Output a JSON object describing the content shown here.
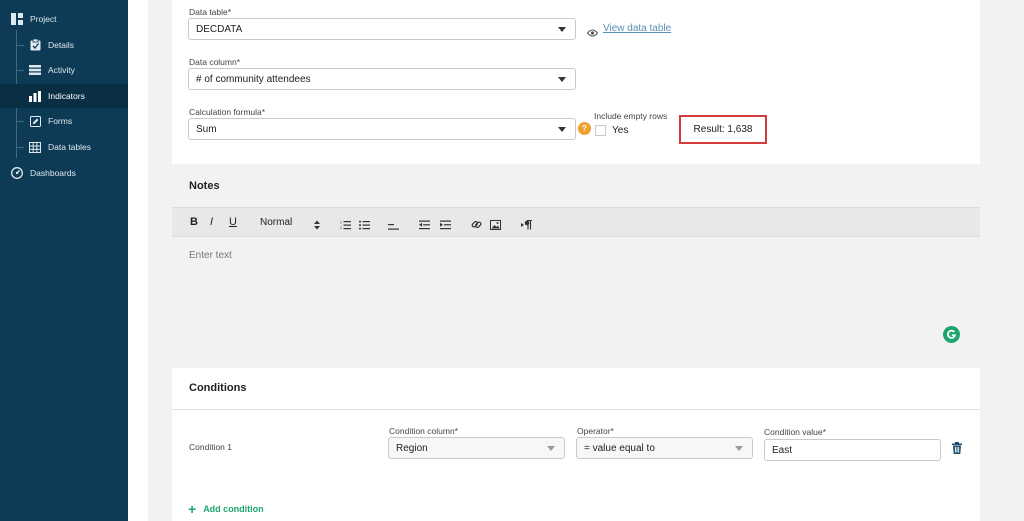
{
  "sidebar": {
    "project": "Project",
    "items": [
      {
        "label": "Details",
        "icon": "clipboard-icon"
      },
      {
        "label": "Activity",
        "icon": "list-icon"
      },
      {
        "label": "Indicators",
        "icon": "bar-chart-icon"
      },
      {
        "label": "Forms",
        "icon": "edit-icon"
      },
      {
        "label": "Data tables",
        "icon": "table-icon"
      }
    ],
    "dashboards": "Dashboards"
  },
  "form": {
    "data_table_label": "Data table*",
    "data_table_value": "DECDATA",
    "view_data_table": "View data table",
    "data_column_label": "Data column*",
    "data_column_value": "# of community attendees",
    "calc_label": "Calculation formula*",
    "calc_value": "Sum",
    "help_badge": "?",
    "include_empty_label": "Include empty rows",
    "yes_label": "Yes",
    "result": "Result: 1,638"
  },
  "notes": {
    "title": "Notes",
    "toolbar": {
      "bold": "B",
      "italic": "I",
      "underline": "U",
      "style_select": "Normal"
    },
    "placeholder": "Enter text"
  },
  "conditions": {
    "title": "Conditions",
    "rows": [
      {
        "label": "Condition 1",
        "column_label": "Condition column*",
        "column_value": "Region",
        "operator_label": "Operator*",
        "operator_value": "= value equal to",
        "value_label": "Condition value*",
        "value": "East"
      }
    ],
    "add_label": "Add condition"
  },
  "colors": {
    "sidebar_bg": "#0d3b56",
    "accent_green": "#1fa66f",
    "result_border": "#d23b3b",
    "help_orange": "#f0a030"
  }
}
